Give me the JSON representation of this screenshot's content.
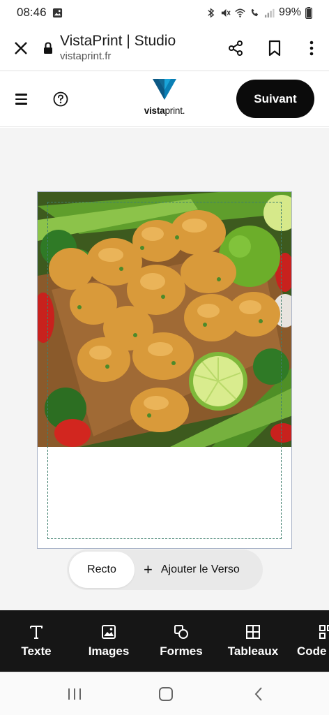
{
  "status_bar": {
    "time": "08:46",
    "battery": "99%"
  },
  "browser": {
    "title": "VistaPrint | Studio",
    "url": "vistaprint.fr",
    "icons": [
      "close-icon",
      "lock-icon",
      "share-icon",
      "bookmark-icon",
      "more-vert-icon"
    ]
  },
  "header": {
    "logo_text_bold": "vista",
    "logo_text_light": "print.",
    "next_label": "Suivant",
    "icons": [
      "menu-icon",
      "help-icon"
    ]
  },
  "canvas": {
    "image_description_hidden": "",
    "side_front": "Recto",
    "side_add_back": "Ajouter le Verso",
    "add_icon": "+"
  },
  "toolbar": {
    "items": [
      {
        "label": "Texte",
        "icon": "text-icon"
      },
      {
        "label": "Images",
        "icon": "image-icon"
      },
      {
        "label": "Formes",
        "icon": "shapes-icon"
      },
      {
        "label": "Tableaux",
        "icon": "table-icon"
      },
      {
        "label": "Code",
        "icon": "qr-code-icon"
      }
    ]
  },
  "navbar": {
    "icons": [
      "recent-apps-icon",
      "home-icon",
      "back-icon"
    ]
  },
  "colors": {
    "brand_dark": "#0b0b0b",
    "logo_blue": "#0a7fb5",
    "safe_area_line": "#3f7f6e",
    "toolbar_bg": "#161616"
  }
}
